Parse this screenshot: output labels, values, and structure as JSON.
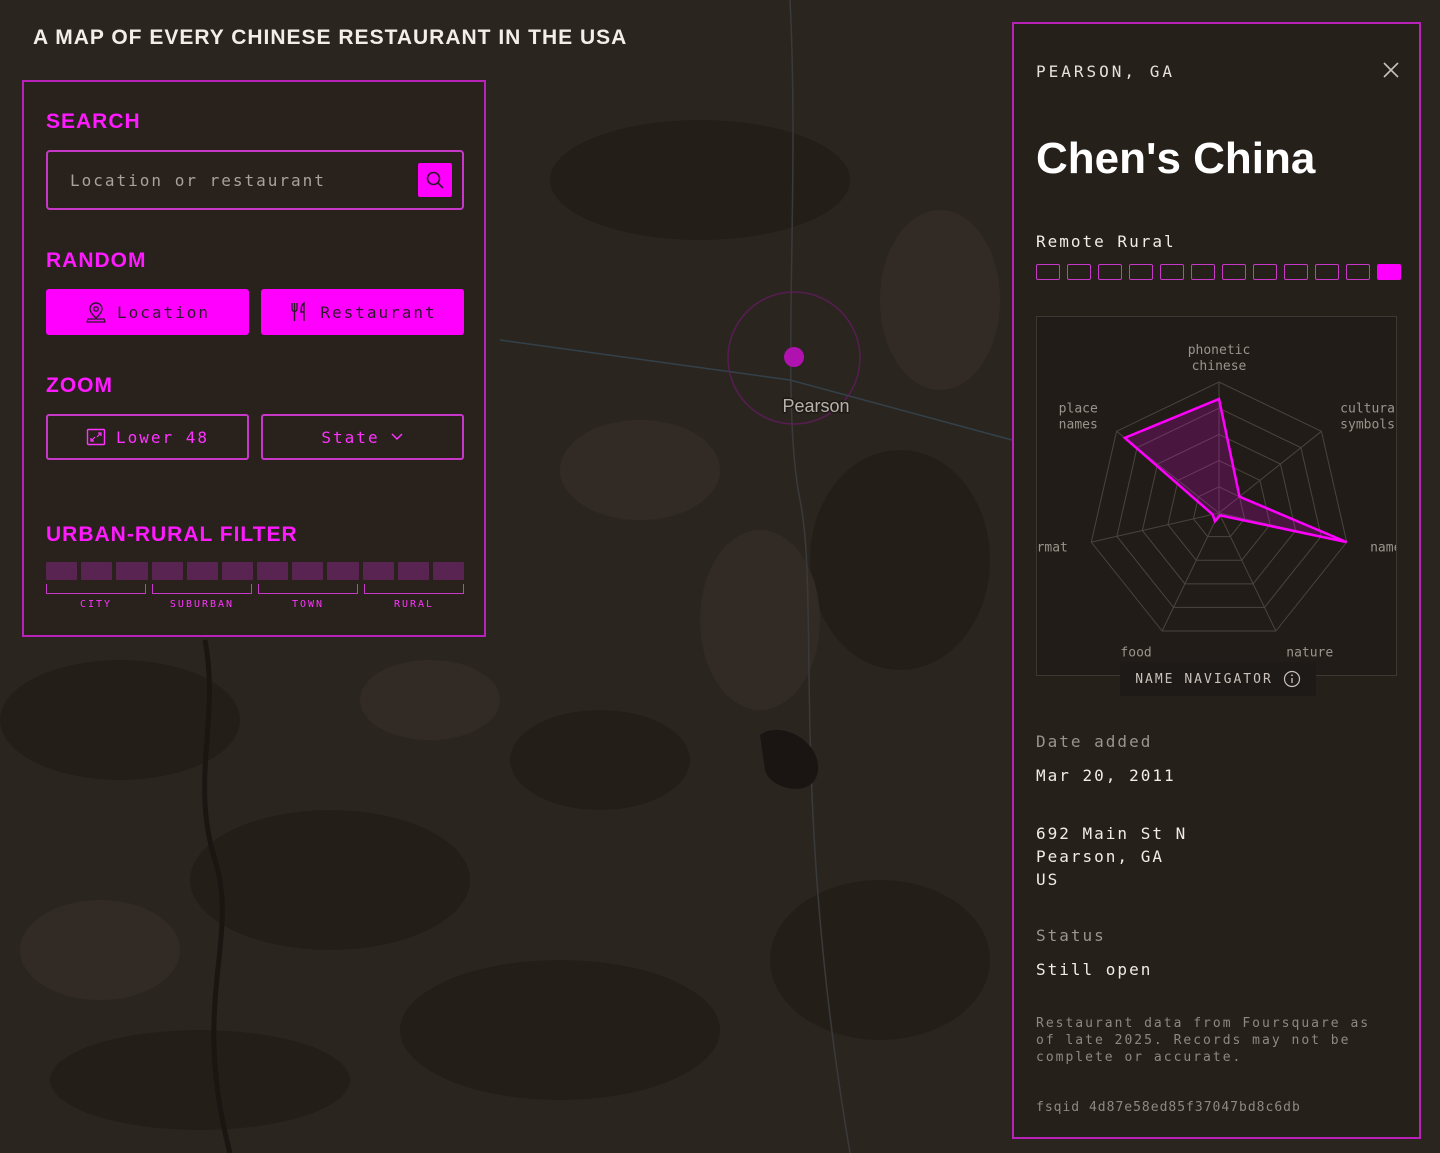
{
  "app": {
    "title": "A MAP OF EVERY CHINESE RESTAURANT IN THE USA"
  },
  "map": {
    "place_label": "Pearson",
    "marker_color": "#b012b0"
  },
  "controls": {
    "search": {
      "heading": "SEARCH",
      "placeholder": "Location or restaurant",
      "value": "",
      "button_icon": "search-icon"
    },
    "random": {
      "heading": "RANDOM",
      "location_label": "Location",
      "location_icon": "map-pin-icon",
      "restaurant_label": "Restaurant",
      "restaurant_icon": "utensils-icon"
    },
    "zoom": {
      "heading": "ZOOM",
      "lower48_label": "Lower 48",
      "lower48_icon": "expand-map-icon",
      "state_label": "State",
      "state_icon": "chevron-down-icon"
    },
    "urban_rural": {
      "heading": "URBAN-RURAL FILTER",
      "segment_count": 12,
      "labels": [
        "CITY",
        "SUBURBAN",
        "TOWN",
        "RURAL"
      ]
    }
  },
  "detail": {
    "location": "PEARSON, GA",
    "name": "Chen's China",
    "classification": "Remote Rural",
    "rural_level": {
      "total": 12,
      "active_index": 11
    },
    "date_label": "Date added",
    "date_value": "Mar 20, 2011",
    "address": {
      "line1": "692 Main St N",
      "line2": "Pearson, GA",
      "line3": "US"
    },
    "status_label": "Status",
    "status_value": "Still open",
    "footnote": "Restaurant data from Foursquare as of late 2025. Records may not be complete or accurate.",
    "fsqid": "fsqid 4d87e58ed85f37047bd8c6db",
    "navigator_label": "NAME NAVIGATOR"
  },
  "chart_data": {
    "type": "radar",
    "axes": [
      {
        "key": "phonetic",
        "label_lines": [
          "phonetic",
          "chinese"
        ]
      },
      {
        "key": "cultural",
        "label_lines": [
          "cultural",
          "symbols"
        ]
      },
      {
        "key": "names",
        "label_lines": [
          "names"
        ]
      },
      {
        "key": "nature",
        "label_lines": [
          "nature"
        ]
      },
      {
        "key": "food",
        "label_lines": [
          "food"
        ]
      },
      {
        "key": "format",
        "label_lines": [
          "format"
        ]
      },
      {
        "key": "place",
        "label_lines": [
          "place",
          "names"
        ]
      }
    ],
    "values": [
      0.87,
      0.2,
      1.0,
      0.01,
      0.07,
      0.05,
      0.92
    ],
    "range": [
      0,
      1
    ],
    "rings": 5,
    "color": "#ff00ff"
  }
}
